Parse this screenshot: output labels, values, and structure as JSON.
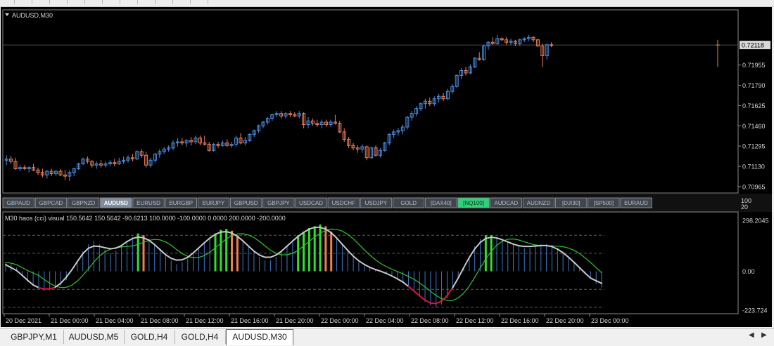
{
  "window": {
    "symbol_title": "AUDUSD,M30",
    "indicator_label": "M30  haos (cci) visual  150.5642 150.5642 -90.6213 100.0000 -100.0000 0.0000 200.0000 -200.0000"
  },
  "symbol_buttons": [
    {
      "label": "GBPAUD",
      "active": false,
      "highlight": false
    },
    {
      "label": "GBPCAD",
      "active": false,
      "highlight": false
    },
    {
      "label": "GBPNZD",
      "active": false,
      "highlight": false
    },
    {
      "label": "AUDUSD",
      "active": true,
      "highlight": false
    },
    {
      "label": "EURUSD",
      "active": false,
      "highlight": false
    },
    {
      "label": "EURGBP",
      "active": false,
      "highlight": false
    },
    {
      "label": "EURJPY",
      "active": false,
      "highlight": false
    },
    {
      "label": "GBPUSD",
      "active": false,
      "highlight": false
    },
    {
      "label": "GBPJPY",
      "active": false,
      "highlight": false
    },
    {
      "label": "USDCAD",
      "active": false,
      "highlight": false
    },
    {
      "label": "USDCHF",
      "active": false,
      "highlight": false
    },
    {
      "label": "USDJPY",
      "active": false,
      "highlight": false
    },
    {
      "label": "GOLD",
      "active": false,
      "highlight": false
    },
    {
      "label": "[DAX40]",
      "active": false,
      "highlight": false
    },
    {
      "label": "[NQ100]",
      "active": false,
      "highlight": true
    },
    {
      "label": "AUDCAD",
      "active": false,
      "highlight": false
    },
    {
      "label": "AUDNZD",
      "active": false,
      "highlight": false
    },
    {
      "label": "[DJI30]",
      "active": false,
      "highlight": false
    },
    {
      "label": "[SP500]",
      "active": false,
      "highlight": false
    },
    {
      "label": "EURAUD",
      "active": false,
      "highlight": false
    }
  ],
  "scale_labels": {
    "top": "100",
    "bottom": "20"
  },
  "tabs": [
    {
      "label": "GBPJPY,M1",
      "active": false
    },
    {
      "label": "AUDUSD,M5",
      "active": false
    },
    {
      "label": "GOLD,H4",
      "active": false
    },
    {
      "label": "GOLD,H4",
      "active": false
    },
    {
      "label": "AUDUSD,M30",
      "active": true
    }
  ],
  "colors": {
    "background": "#000000",
    "bull": "#4a90e2",
    "bear": "#f07f58",
    "grid_line": "#5a5a5a",
    "panel_border": "#8a8a8a",
    "cci_histogram": "#3d78c8",
    "cci_green": "#2ee02e",
    "cci_orange": "#f08050",
    "line_green": "#2ec42e",
    "line_white": "#c8c8c8",
    "line_red": "#dc143c",
    "active_button": "#7e8c9c",
    "highlight_button": "#2fd07a"
  },
  "icons": {
    "collapse": "triangle-down-icon",
    "scroll_left": "chevron-left-icon",
    "scroll_right": "chevron-right-icon"
  },
  "chart_data": [
    {
      "type": "candlestick",
      "title": "AUDUSD,M30",
      "y_tick_labels": [
        "0.72118",
        "0.71955",
        "0.71790",
        "0.71625",
        "0.71460",
        "0.71295",
        "0.71130",
        "0.70965"
      ],
      "current_price": "0.72118",
      "ylim": [
        0.7093,
        0.7237
      ],
      "x_tick_labels": [
        "20 Dec 2021",
        "21 Dec 00:00",
        "21 Dec 04:00",
        "21 Dec 08:00",
        "21 Dec 12:00",
        "21 Dec 16:00",
        "21 Dec 20:00",
        "22 Dec 00:00",
        "22 Dec 04:00",
        "22 Dec 08:00",
        "22 Dec 12:00",
        "22 Dec 16:00",
        "22 Dec 20:00",
        "23 Dec 00:00"
      ],
      "x_tick_index": [
        0,
        10,
        20,
        30,
        40,
        50,
        60,
        70,
        80,
        90,
        100,
        110,
        120,
        130
      ],
      "candles": [
        [
          0.7118,
          0.7122,
          0.7114,
          0.7119
        ],
        [
          0.7119,
          0.71215,
          0.7115,
          0.7117
        ],
        [
          0.7117,
          0.712,
          0.711,
          0.7111
        ],
        [
          0.7111,
          0.7114,
          0.7109,
          0.7112
        ],
        [
          0.7112,
          0.7114,
          0.711,
          0.7111
        ],
        [
          0.7111,
          0.7113,
          0.7108,
          0.7112
        ],
        [
          0.7112,
          0.7115,
          0.7109,
          0.711
        ],
        [
          0.711,
          0.7112,
          0.7106,
          0.7108
        ],
        [
          0.7108,
          0.7111,
          0.7104,
          0.7106
        ],
        [
          0.7106,
          0.711,
          0.7103,
          0.7109
        ],
        [
          0.7109,
          0.7111,
          0.7105,
          0.7107
        ],
        [
          0.7107,
          0.711,
          0.7105,
          0.7109
        ],
        [
          0.7109,
          0.7111,
          0.7105,
          0.7106
        ],
        [
          0.7106,
          0.711,
          0.7102,
          0.7105
        ],
        [
          0.7105,
          0.711,
          0.7101,
          0.7108
        ],
        [
          0.7108,
          0.7112,
          0.7105,
          0.7111
        ],
        [
          0.7111,
          0.7116,
          0.711,
          0.7115
        ],
        [
          0.7115,
          0.712,
          0.7114,
          0.7119
        ],
        [
          0.7119,
          0.7121,
          0.7115,
          0.7117
        ],
        [
          0.7117,
          0.7118,
          0.7112,
          0.7114
        ],
        [
          0.7114,
          0.7117,
          0.7111,
          0.7115
        ],
        [
          0.7115,
          0.7118,
          0.7112,
          0.7114
        ],
        [
          0.7114,
          0.7117,
          0.7112,
          0.7115
        ],
        [
          0.7115,
          0.7118,
          0.7113,
          0.7116
        ],
        [
          0.7116,
          0.7119,
          0.7113,
          0.7115
        ],
        [
          0.7115,
          0.712,
          0.7114,
          0.7117
        ],
        [
          0.7117,
          0.7121,
          0.7115,
          0.7118
        ],
        [
          0.7118,
          0.7122,
          0.7116,
          0.712
        ],
        [
          0.712,
          0.7123,
          0.7117,
          0.7119
        ],
        [
          0.7119,
          0.7126,
          0.7118,
          0.7125
        ],
        [
          0.7125,
          0.7127,
          0.712,
          0.7122
        ],
        [
          0.7122,
          0.7125,
          0.7112,
          0.7114
        ],
        [
          0.7114,
          0.712,
          0.7112,
          0.7118
        ],
        [
          0.7118,
          0.7124,
          0.7116,
          0.7123
        ],
        [
          0.7123,
          0.7127,
          0.712,
          0.7125
        ],
        [
          0.7125,
          0.7129,
          0.7123,
          0.7127
        ],
        [
          0.7127,
          0.713,
          0.7125,
          0.7128
        ],
        [
          0.7128,
          0.7134,
          0.7126,
          0.7132
        ],
        [
          0.7132,
          0.7136,
          0.7129,
          0.7133
        ],
        [
          0.7133,
          0.7136,
          0.713,
          0.7132
        ],
        [
          0.7132,
          0.7135,
          0.7129,
          0.7134
        ],
        [
          0.7134,
          0.7137,
          0.713,
          0.7133
        ],
        [
          0.7133,
          0.7138,
          0.7131,
          0.7136
        ],
        [
          0.7136,
          0.7138,
          0.713,
          0.7132
        ],
        [
          0.7132,
          0.7138,
          0.713,
          0.7131
        ],
        [
          0.7131,
          0.7133,
          0.7125,
          0.7126
        ],
        [
          0.7126,
          0.7132,
          0.7125,
          0.7131
        ],
        [
          0.7131,
          0.7133,
          0.7128,
          0.713
        ],
        [
          0.713,
          0.7134,
          0.7129,
          0.7132
        ],
        [
          0.7132,
          0.7135,
          0.7129,
          0.713
        ],
        [
          0.713,
          0.7133,
          0.7128,
          0.7131
        ],
        [
          0.7131,
          0.7138,
          0.7129,
          0.7136
        ],
        [
          0.7136,
          0.714,
          0.7131,
          0.7132
        ],
        [
          0.7132,
          0.7137,
          0.713,
          0.7134
        ],
        [
          0.7134,
          0.714,
          0.7133,
          0.7139
        ],
        [
          0.7139,
          0.7143,
          0.7137,
          0.7142
        ],
        [
          0.7142,
          0.7147,
          0.714,
          0.7146
        ],
        [
          0.7146,
          0.715,
          0.7144,
          0.7149
        ],
        [
          0.7149,
          0.7153,
          0.7147,
          0.7152
        ],
        [
          0.7152,
          0.7156,
          0.715,
          0.7155
        ],
        [
          0.7155,
          0.7158,
          0.7153,
          0.7156
        ],
        [
          0.7156,
          0.7158,
          0.7152,
          0.7154
        ],
        [
          0.7154,
          0.7157,
          0.7152,
          0.7156
        ],
        [
          0.7156,
          0.7158,
          0.7153,
          0.7155
        ],
        [
          0.7155,
          0.7157,
          0.7153,
          0.7154
        ],
        [
          0.7154,
          0.7158,
          0.7152,
          0.7156
        ],
        [
          0.7156,
          0.7157,
          0.7144,
          0.7147
        ],
        [
          0.7147,
          0.7153,
          0.7144,
          0.715
        ],
        [
          0.715,
          0.7152,
          0.7146,
          0.7148
        ],
        [
          0.7148,
          0.7151,
          0.7145,
          0.7147
        ],
        [
          0.7147,
          0.7151,
          0.7144,
          0.7149
        ],
        [
          0.7149,
          0.7151,
          0.7145,
          0.7147
        ],
        [
          0.7147,
          0.7151,
          0.7145,
          0.7149
        ],
        [
          0.7149,
          0.7155,
          0.7147,
          0.7148
        ],
        [
          0.7148,
          0.715,
          0.714,
          0.7141
        ],
        [
          0.7141,
          0.7144,
          0.7133,
          0.7135
        ],
        [
          0.7135,
          0.7137,
          0.7128,
          0.713
        ],
        [
          0.713,
          0.7132,
          0.7126,
          0.7128
        ],
        [
          0.7128,
          0.713,
          0.7124,
          0.7127
        ],
        [
          0.7127,
          0.7131,
          0.7124,
          0.7129
        ],
        [
          0.7129,
          0.713,
          0.7118,
          0.712
        ],
        [
          0.712,
          0.7129,
          0.7119,
          0.7128
        ],
        [
          0.7128,
          0.713,
          0.7121,
          0.7122
        ],
        [
          0.7122,
          0.7128,
          0.712,
          0.7126
        ],
        [
          0.7126,
          0.7133,
          0.7125,
          0.7132
        ],
        [
          0.7132,
          0.714,
          0.713,
          0.7139
        ],
        [
          0.7139,
          0.7143,
          0.7136,
          0.7141
        ],
        [
          0.7141,
          0.7144,
          0.7138,
          0.7142
        ],
        [
          0.7142,
          0.7147,
          0.7139,
          0.7145
        ],
        [
          0.7145,
          0.7154,
          0.7143,
          0.7153
        ],
        [
          0.7153,
          0.7158,
          0.715,
          0.7156
        ],
        [
          0.7156,
          0.7162,
          0.7154,
          0.716
        ],
        [
          0.716,
          0.7165,
          0.7158,
          0.7164
        ],
        [
          0.7164,
          0.7168,
          0.716,
          0.7166
        ],
        [
          0.7166,
          0.7169,
          0.7162,
          0.7164
        ],
        [
          0.7164,
          0.717,
          0.7162,
          0.7168
        ],
        [
          0.7168,
          0.7172,
          0.7165,
          0.717
        ],
        [
          0.717,
          0.7173,
          0.7166,
          0.7168
        ],
        [
          0.7168,
          0.7176,
          0.7167,
          0.7174
        ],
        [
          0.7174,
          0.718,
          0.7172,
          0.7178
        ],
        [
          0.7178,
          0.7188,
          0.7177,
          0.7187
        ],
        [
          0.7187,
          0.7193,
          0.7184,
          0.7191
        ],
        [
          0.7191,
          0.7194,
          0.7187,
          0.7189
        ],
        [
          0.7189,
          0.7196,
          0.7188,
          0.7194
        ],
        [
          0.7194,
          0.7202,
          0.7193,
          0.7201
        ],
        [
          0.7201,
          0.7206,
          0.7199,
          0.72
        ],
        [
          0.72,
          0.7212,
          0.7199,
          0.7211
        ],
        [
          0.7211,
          0.7215,
          0.7208,
          0.7214
        ],
        [
          0.7214,
          0.7218,
          0.7212,
          0.7213
        ],
        [
          0.7213,
          0.722,
          0.7212,
          0.7217
        ],
        [
          0.7217,
          0.7218,
          0.7215,
          0.7216
        ],
        [
          0.7216,
          0.7218,
          0.7212,
          0.7214
        ],
        [
          0.7214,
          0.7217,
          0.7212,
          0.7215
        ],
        [
          0.7215,
          0.7216,
          0.7211,
          0.7213
        ],
        [
          0.7213,
          0.7217,
          0.7211,
          0.7216
        ],
        [
          0.7216,
          0.7218,
          0.7214,
          0.7217
        ],
        [
          0.7217,
          0.722,
          0.7215,
          0.7218
        ],
        [
          0.7218,
          0.7219,
          0.7214,
          0.7216
        ],
        [
          0.7216,
          0.7217,
          0.721,
          0.7211
        ],
        [
          0.7211,
          0.7213,
          0.7194,
          0.7203
        ],
        [
          0.7203,
          0.7213,
          0.72,
          0.7212
        ],
        [
          0.7212,
          0.7214,
          0.721,
          0.72118
        ]
      ],
      "last_tick": {
        "high": 0.7216,
        "low": 0.7194,
        "close": 0.72118
      }
    },
    {
      "type": "line",
      "title": "haos (cci) visual",
      "y_tick_labels": [
        "298.2045",
        "0.00",
        "-223.724"
      ],
      "ylim": [
        -223.724,
        298.2045
      ],
      "levels": [
        200,
        100,
        0,
        -100,
        -200
      ],
      "series": [
        {
          "values": [
            50,
            40,
            20,
            -30,
            -60,
            -80,
            -100,
            -110,
            -105,
            -95,
            -80,
            -50,
            0,
            60,
            110,
            150,
            170,
            150,
            120,
            100,
            115,
            140,
            170,
            190,
            210,
            200,
            180,
            150,
            120,
            90,
            60,
            40,
            50,
            70,
            100,
            130,
            160,
            190,
            210,
            230,
            235,
            225,
            200,
            170,
            140,
            110,
            80,
            60,
            60,
            80,
            110,
            140,
            170,
            200,
            220,
            240,
            250,
            260,
            250,
            220,
            190,
            150,
            110,
            80,
            50,
            30,
            20,
            10,
            0,
            -10,
            -20,
            -40,
            -60,
            -80,
            -100,
            -140,
            -170,
            -190,
            -200,
            -185,
            -150,
            -100,
            -40,
            20,
            80,
            140,
            180,
            200,
            200,
            190,
            175,
            160,
            150,
            140,
            130,
            130,
            140,
            150,
            150,
            145,
            130,
            110,
            80,
            50,
            20,
            -10,
            -40,
            -70,
            -90
          ]
        }
      ]
    }
  ]
}
